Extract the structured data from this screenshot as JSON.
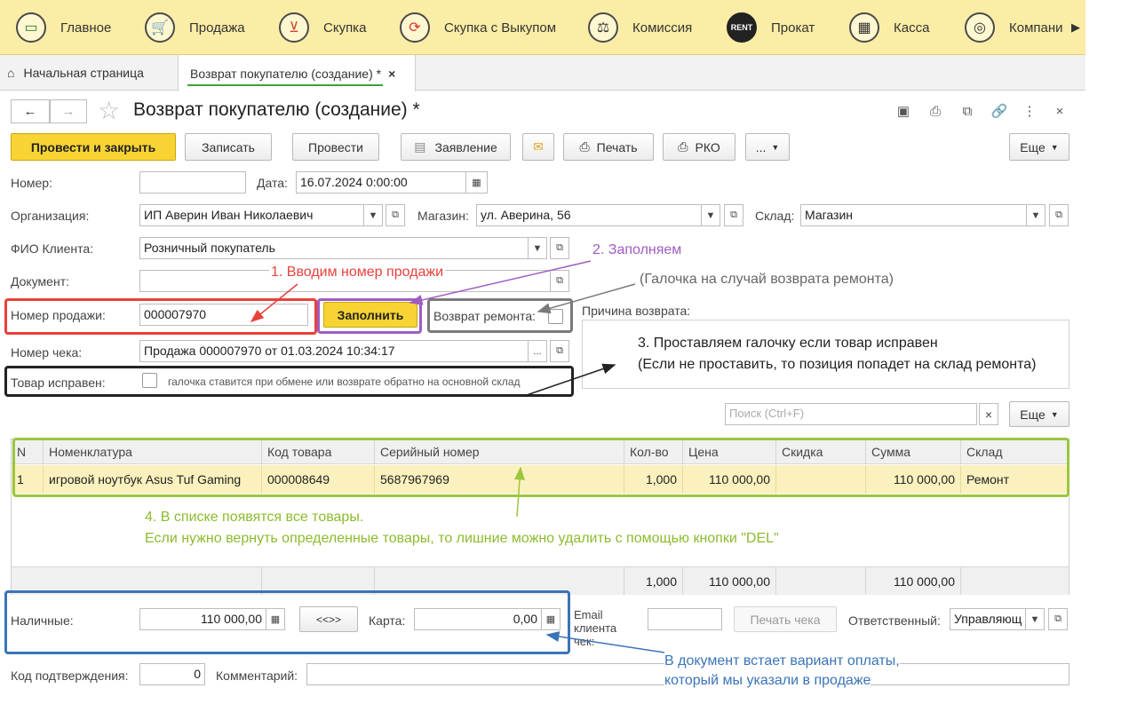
{
  "menu": {
    "items": [
      {
        "label": "Главное",
        "icon": "monitor-icon"
      },
      {
        "label": "Продажа",
        "icon": "cart-icon"
      },
      {
        "label": "Скупка",
        "icon": "basket-icon"
      },
      {
        "label": "Скупка с Выкупом",
        "icon": "refresh-icon"
      },
      {
        "label": "Комиссия",
        "icon": "scales-icon"
      },
      {
        "label": "Прокат",
        "icon": "rent-icon",
        "badge": "RENT"
      },
      {
        "label": "Касса",
        "icon": "cash-register-icon"
      },
      {
        "label": "Компани",
        "icon": "company-icon"
      }
    ]
  },
  "tabs": {
    "home": "Начальная страница",
    "active": "Возврат покупателю (создание) *",
    "close": "×"
  },
  "title": "Возврат покупателю (создание) *",
  "nav": {
    "back": "←",
    "forward": "→",
    "star": "☆"
  },
  "toolbar": {
    "post_close": "Провести и закрыть",
    "save": "Записать",
    "post": "Провести",
    "statement": "Заявление",
    "print": "Печать",
    "rko": "РКО",
    "more_dots": "...",
    "more": "Еще"
  },
  "form": {
    "number_label": "Номер:",
    "number_value": "",
    "date_label": "Дата:",
    "date_value": "16.07.2024  0:00:00",
    "org_label": "Организация:",
    "org_value": "ИП Аверин Иван Николаевич",
    "store_label": "Магазин:",
    "store_value": "ул. Аверина, 56",
    "warehouse_label": "Склад:",
    "warehouse_value": "Магазин",
    "client_label": "ФИО Клиента:",
    "client_value": "Розничный покупатель",
    "document_label": "Документ:",
    "document_value": "",
    "sale_number_label": "Номер продажи:",
    "sale_number_value": "000007970",
    "fill_button": "Заполнить",
    "repair_return_label": "Возврат ремонта:",
    "reason_label": "Причина возврата:",
    "receipt_label": "Номер чека:",
    "receipt_value": "Продажа 000007970 от 01.03.2024 10:34:17",
    "goods_ok_label": "Товар исправен:",
    "goods_ok_hint": "галочка ставится при обмене или возврате обратно на основной склад",
    "search_placeholder": "Поиск (Ctrl+F)",
    "search_clear": "×",
    "more": "Еще"
  },
  "table": {
    "columns": [
      "N",
      "Номенклатура",
      "Код товара",
      "Серийный номер",
      "Кол-во",
      "Цена",
      "Скидка",
      "Сумма",
      "Склад"
    ],
    "rows": [
      [
        "1",
        "игровой ноутбук Asus Tuf Gaming",
        "000008649",
        "5687967969",
        "1,000",
        "110 000,00",
        "",
        "110 000,00",
        "Ремонт"
      ]
    ],
    "footer": {
      "qty": "1,000",
      "price": "110 000,00",
      "sum": "110 000,00"
    }
  },
  "payment": {
    "cash_label": "Наличные:",
    "cash_value": "110 000,00",
    "swap_button": "<<>>",
    "card_label": "Карта:",
    "card_value": "0,00",
    "email_label": "Email клиента чек:",
    "email_value": "",
    "print_receipt": "Печать чека",
    "responsible_label": "Ответственный:",
    "responsible_value": "Управляющ",
    "confirm_code_label": "Код подтверждения:",
    "confirm_code_value": "0",
    "comment_label": "Комментарий:",
    "comment_value": ""
  },
  "annotations": {
    "a1": "1. Вводим номер продажи",
    "a2": "2. Заполняем",
    "a2b": "(Галочка на случай возврата ремонта)",
    "a3_line1": "3. Проставляем галочку если товар исправен",
    "a3_line2": "(Если не проставить, то позиция попадет на склад ремонта)",
    "a4_line1": "4. В списке появятся все товары.",
    "a4_line2": "Если нужно вернуть определенные товары, то лишние можно удалить с помощью кнопки \"DEL\"",
    "a5_line1": "В документ встает вариант оплаты,",
    "a5_line2": "который мы указали в продаже"
  },
  "colors": {
    "red": "#e8413b",
    "purple": "#a05cc0",
    "gray": "#7a7a7a",
    "black": "#222222",
    "green": "#9bc63e",
    "blue": "#3a74b8",
    "accent": "#f7d433"
  }
}
